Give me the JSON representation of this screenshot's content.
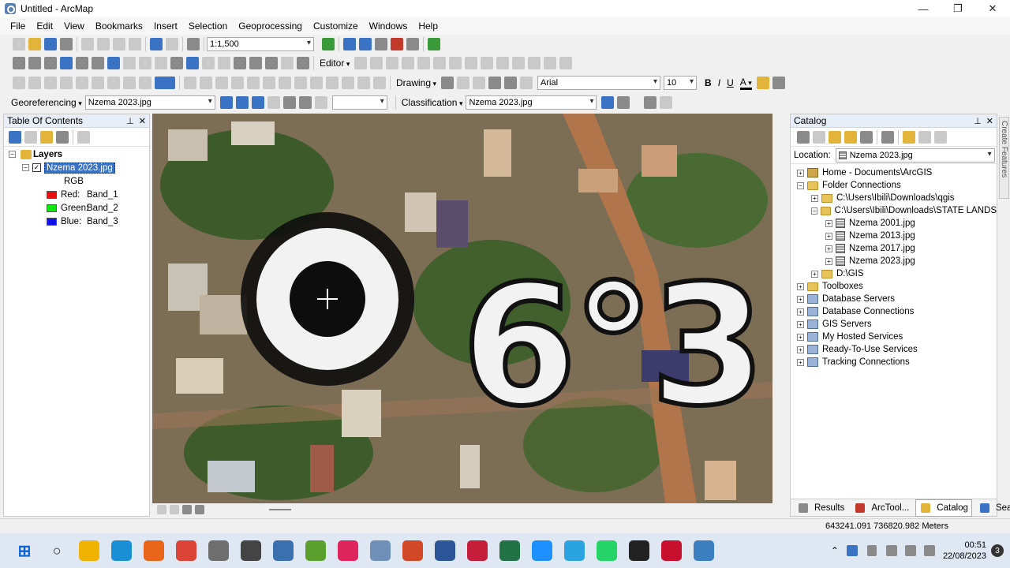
{
  "window": {
    "title": "Untitled - ArcMap",
    "min": "—",
    "max": "❐",
    "close": "✕"
  },
  "menu": [
    "File",
    "Edit",
    "View",
    "Bookmarks",
    "Insert",
    "Selection",
    "Geoprocessing",
    "Customize",
    "Windows",
    "Help"
  ],
  "toolbar": {
    "scale": "1:1,500",
    "editor": "Editor",
    "drawing": "Drawing",
    "font_name": "Arial",
    "font_size": "10",
    "georeferencing": "Georeferencing",
    "geo_layer": "Nzema 2023.jpg",
    "classification": "Classification",
    "class_layer": "Nzema 2023.jpg",
    "bold": "B",
    "italic": "I",
    "underline": "U",
    "font_color": "A"
  },
  "toc": {
    "title": "Table Of Contents",
    "root": "Layers",
    "layer": "Nzema 2023.jpg",
    "sub": "RGB",
    "bands": [
      {
        "label": "Red:",
        "band": "Band_1",
        "color": "#e81010"
      },
      {
        "label": "Green:",
        "band": "Band_2",
        "color": "#10e810"
      },
      {
        "label": "Blue:",
        "band": "Band_3",
        "color": "#1010e8"
      }
    ]
  },
  "map": {
    "overlay_text": "6°3"
  },
  "catalog": {
    "title": "Catalog",
    "location_label": "Location:",
    "location_value": "Nzema 2023.jpg",
    "items": [
      {
        "text": "Home - Documents\\ArcGIS",
        "level": 0,
        "toggle": "+",
        "icon": "home"
      },
      {
        "text": "Folder Connections",
        "level": 0,
        "toggle": "−",
        "icon": "folder"
      },
      {
        "text": "C:\\Users\\Ibili\\Downloads\\qgis",
        "level": 1,
        "toggle": "+",
        "icon": "folder"
      },
      {
        "text": "C:\\Users\\Ibili\\Downloads\\STATE LANDS",
        "level": 1,
        "toggle": "−",
        "icon": "folder"
      },
      {
        "text": "Nzema 2001.jpg",
        "level": 2,
        "toggle": "+",
        "icon": "raster"
      },
      {
        "text": "Nzema 2013.jpg",
        "level": 2,
        "toggle": "+",
        "icon": "raster"
      },
      {
        "text": "Nzema 2017.jpg",
        "level": 2,
        "toggle": "+",
        "icon": "raster"
      },
      {
        "text": "Nzema 2023.jpg",
        "level": 2,
        "toggle": "+",
        "icon": "raster"
      },
      {
        "text": "D:\\GIS",
        "level": 1,
        "toggle": "+",
        "icon": "folder"
      },
      {
        "text": "Toolboxes",
        "level": 0,
        "toggle": "+",
        "icon": "folder"
      },
      {
        "text": "Database Servers",
        "level": 0,
        "toggle": "+",
        "icon": "service"
      },
      {
        "text": "Database Connections",
        "level": 0,
        "toggle": "+",
        "icon": "service"
      },
      {
        "text": "GIS Servers",
        "level": 0,
        "toggle": "+",
        "icon": "service"
      },
      {
        "text": "My Hosted Services",
        "level": 0,
        "toggle": "+",
        "icon": "service"
      },
      {
        "text": "Ready-To-Use Services",
        "level": 0,
        "toggle": "+",
        "icon": "service"
      },
      {
        "text": "Tracking Connections",
        "level": 0,
        "toggle": "+",
        "icon": "service"
      }
    ],
    "tabs": [
      "Results",
      "ArcTool...",
      "Catalog",
      "Search"
    ]
  },
  "side_tab": "Create Features",
  "status": {
    "coords": "643241.091  736820.982 Meters"
  },
  "taskbar": {
    "time": "00:51",
    "date": "22/08/2023",
    "badge": "3"
  }
}
